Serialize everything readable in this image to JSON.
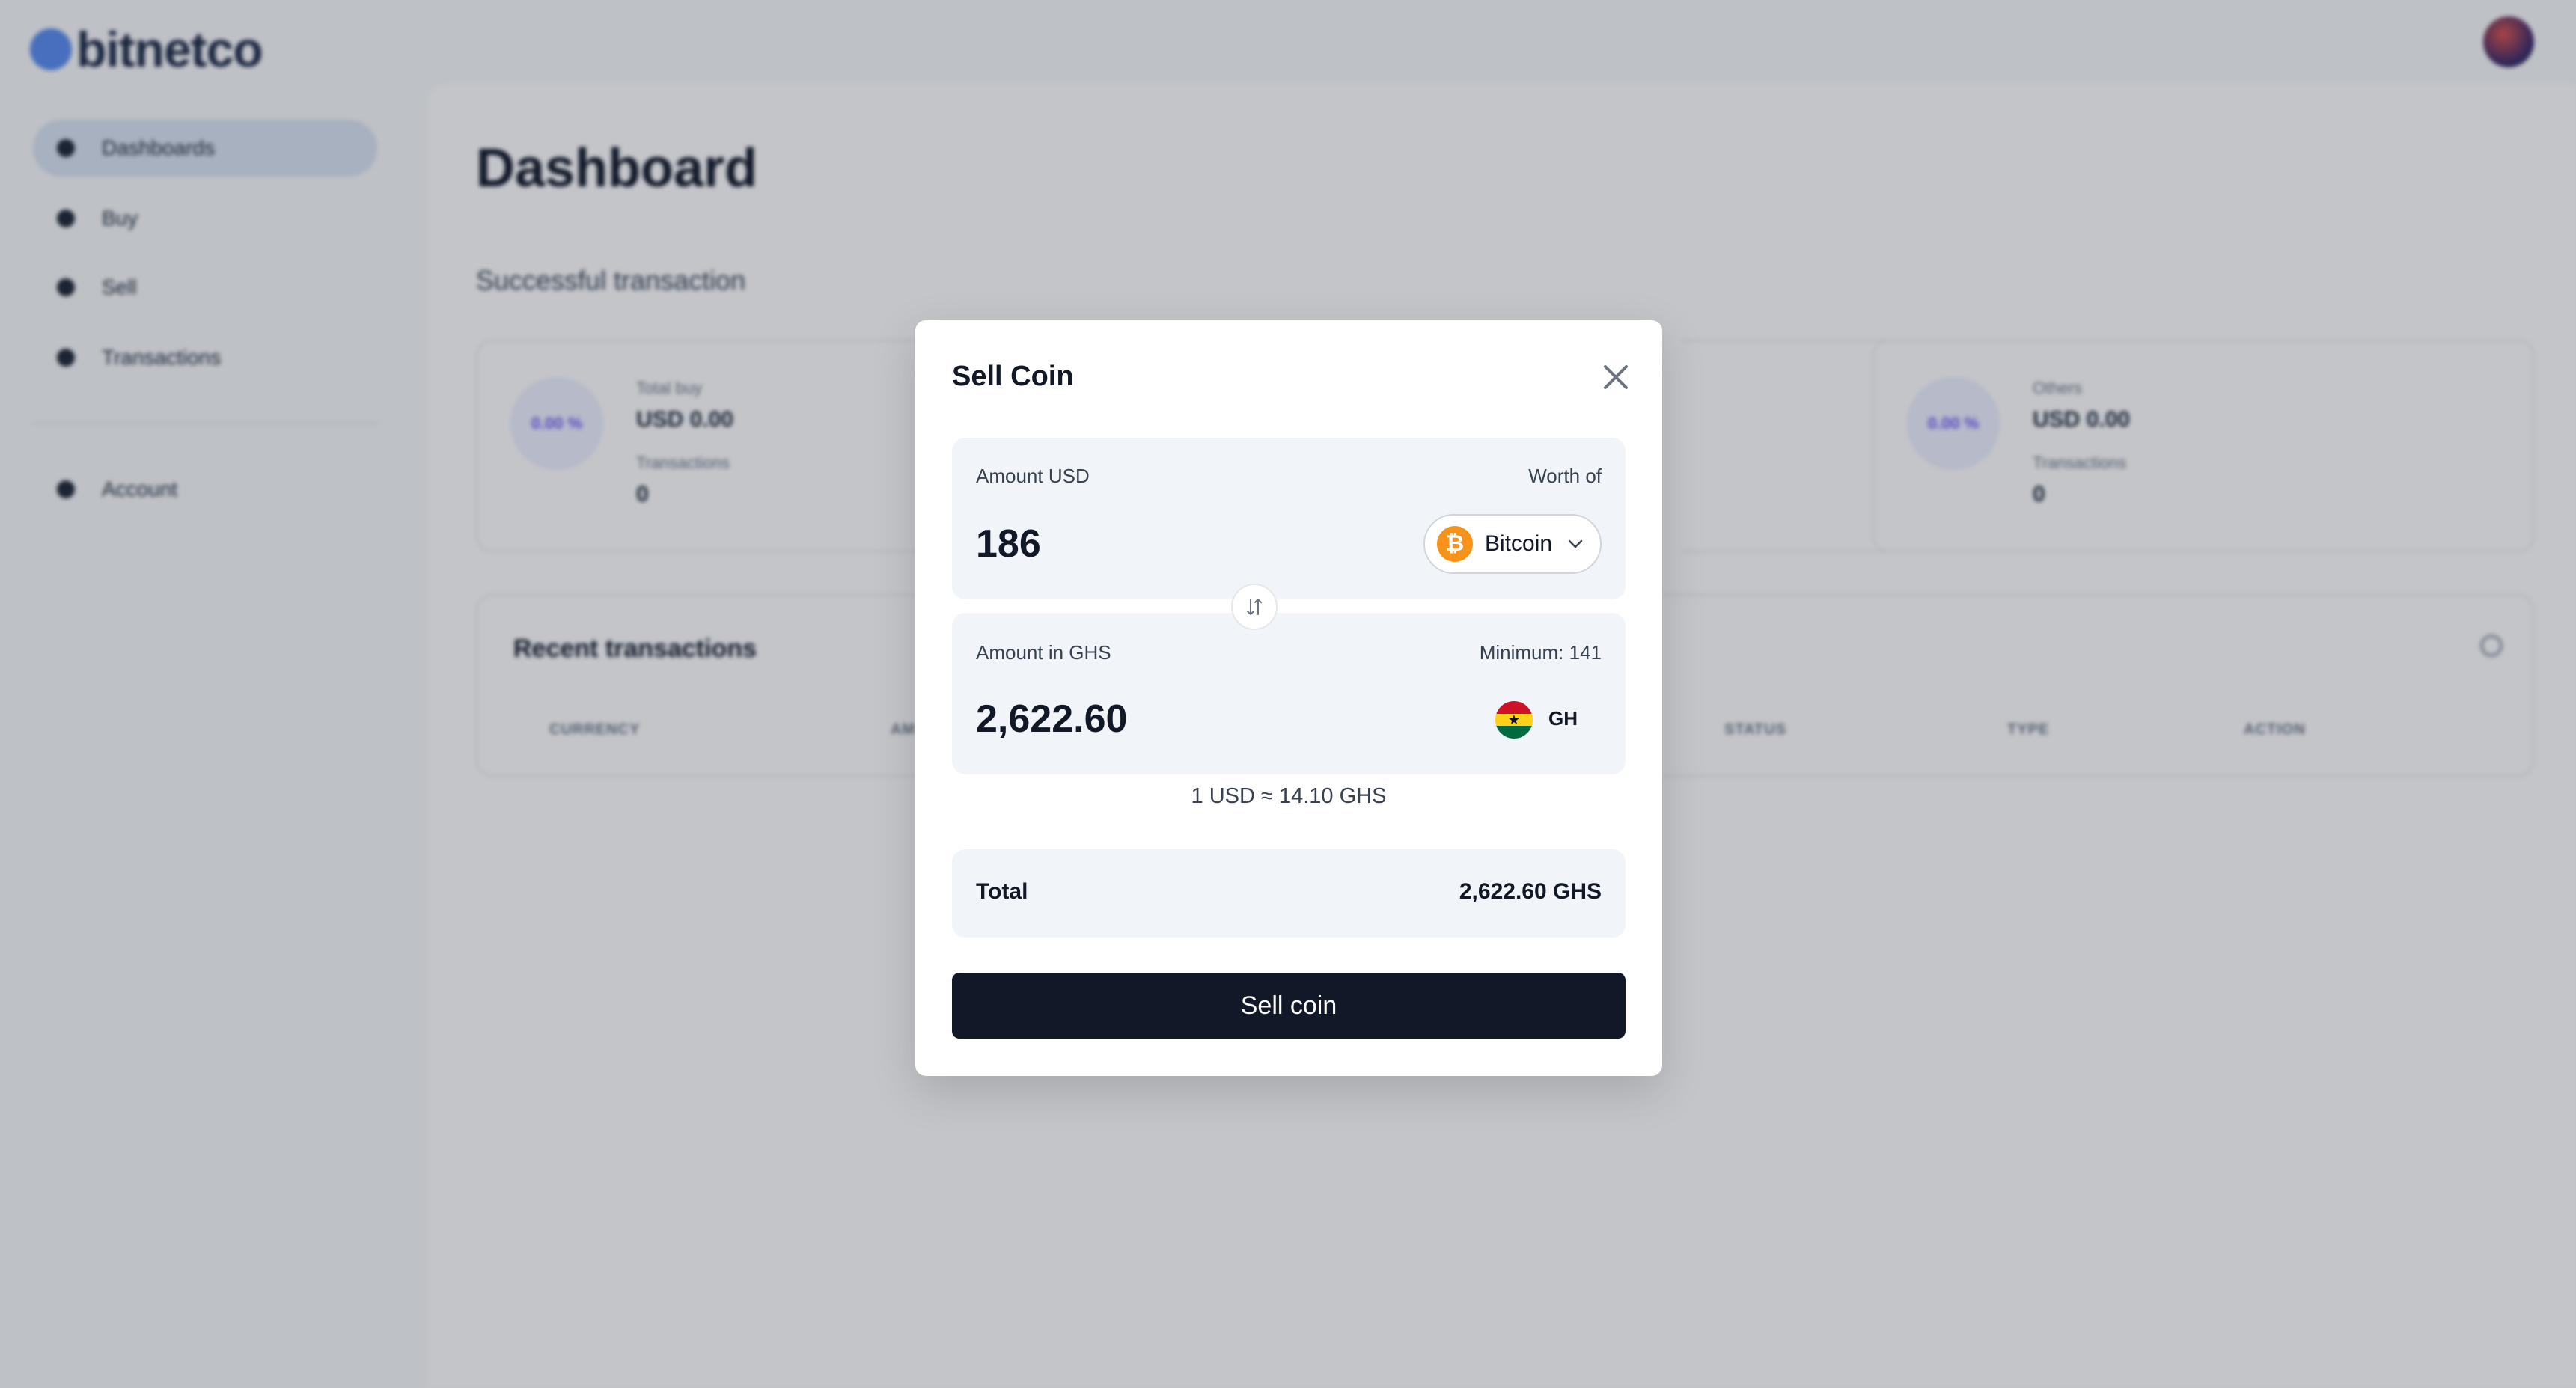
{
  "app": {
    "brand": "bitnetco"
  },
  "sidebar": {
    "items": [
      {
        "label": "Dashboards"
      },
      {
        "label": "Buy"
      },
      {
        "label": "Sell"
      },
      {
        "label": "Transactions"
      },
      {
        "label": "Account"
      }
    ]
  },
  "dashboard": {
    "title": "Dashboard",
    "section_title": "Successful transaction",
    "cards": [
      {
        "percent": "0.00 %",
        "label": "Total buy",
        "value": "USD 0.00",
        "tx_label": "Transactions",
        "tx_count": "0"
      },
      {
        "percent": "0.00 %",
        "label": "Others",
        "value": "USD 0.00",
        "tx_label": "Transactions",
        "tx_count": "0"
      }
    ],
    "recent": {
      "title": "Recent transactions",
      "columns": [
        "CURRENCY",
        "AM",
        "STATUS",
        "TYPE",
        "ACTION"
      ]
    }
  },
  "modal": {
    "title": "Sell Coin",
    "usd_panel": {
      "label": "Amount USD",
      "worth_label": "Worth of",
      "amount": "186",
      "coin": "Bitcoin",
      "coin_icon": "bitcoin-icon"
    },
    "ghs_panel": {
      "label": "Amount in GHS",
      "minimum": "Minimum: 141",
      "amount": "2,622.60",
      "currency_code": "GH",
      "flag_icon": "ghana-flag-icon"
    },
    "rate": "1 USD ≈ 14.10 GHS",
    "total": {
      "label": "Total",
      "value": "2,622.60 GHS"
    },
    "submit_label": "Sell coin"
  },
  "colors": {
    "primary_button": "#111827",
    "panel_bg": "#f1f4f9",
    "bitcoin": "#f7931a",
    "overlay": "rgba(17,24,39,0.25)"
  }
}
